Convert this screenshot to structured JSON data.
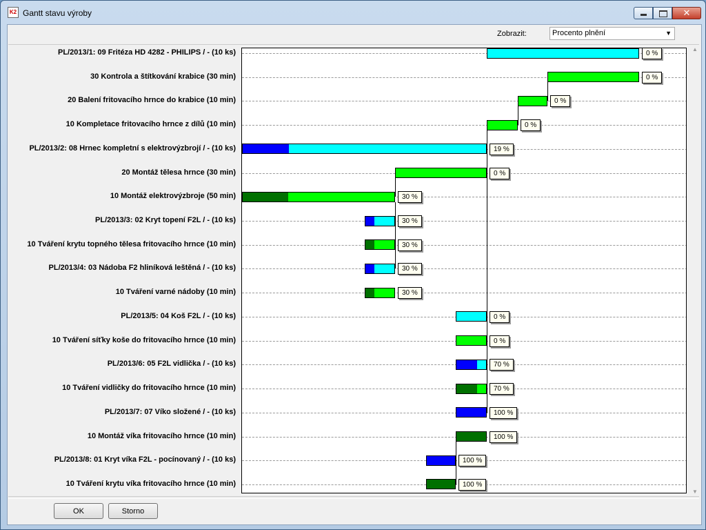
{
  "window": {
    "title": "Gantt stavu výroby",
    "icon": "app-logo-icon",
    "icon_text": "K2"
  },
  "toolbar": {
    "show_label": "Zobrazit:",
    "show_value": "Procento plnění"
  },
  "buttons": {
    "ok": "OK",
    "cancel": "Storno"
  },
  "colors": {
    "order_remaining": "#00ffff",
    "order_done": "#0000ff",
    "operation_remaining": "#00ff00",
    "operation_done": "#007000"
  },
  "gantt": {
    "rows": [
      {
        "label": "PL/2013/1: 09 Fritéza HD 4282 - PHILIPS / - (10 ks)",
        "kind": "order",
        "start": 0.582,
        "end": 0.945,
        "progress": 0,
        "percent": "0 %"
      },
      {
        "label": "30 Kontrola a štítkování krabice (30 min)",
        "kind": "operation",
        "start": 0.727,
        "end": 0.945,
        "progress": 0,
        "percent": "0 %"
      },
      {
        "label": "20 Balení fritovacího hrnce do krabice (10 min)",
        "kind": "operation",
        "start": 0.655,
        "end": 0.727,
        "progress": 0,
        "percent": "0 %"
      },
      {
        "label": "10 Kompletace fritovacího hrnce z dílů (10 min)",
        "kind": "operation",
        "start": 0.582,
        "end": 0.655,
        "progress": 0,
        "percent": "0 %"
      },
      {
        "label": "PL/2013/2: 08 Hrnec kompletní s elektrovýzbrojí / - (10 ks)",
        "kind": "order",
        "start": 0.0,
        "end": 0.582,
        "progress": 0.19,
        "percent": "19 %"
      },
      {
        "label": "20 Montáž tělesa hrnce (30 min)",
        "kind": "operation",
        "start": 0.364,
        "end": 0.582,
        "progress": 0,
        "percent": "0 %"
      },
      {
        "label": "10 Montáž elektrovýzbroje (50 min)",
        "kind": "operation",
        "start": 0.0,
        "end": 0.364,
        "progress": 0.3,
        "percent": "30 %"
      },
      {
        "label": "PL/2013/3: 02 Kryt topení F2L / - (10 ks)",
        "kind": "order",
        "start": 0.291,
        "end": 0.364,
        "progress": 0.3,
        "percent": "30 %"
      },
      {
        "label": "10 Tváření krytu topného tělesa fritovacího hrnce (10 min)",
        "kind": "operation",
        "start": 0.291,
        "end": 0.364,
        "progress": 0.3,
        "percent": "30 %"
      },
      {
        "label": "PL/2013/4: 03 Nádoba F2 hliníková leštěná / - (10 ks)",
        "kind": "order",
        "start": 0.291,
        "end": 0.364,
        "progress": 0.3,
        "percent": "30 %"
      },
      {
        "label": "10 Tváření varné nádoby (10 min)",
        "kind": "operation",
        "start": 0.291,
        "end": 0.364,
        "progress": 0.3,
        "percent": "30 %"
      },
      {
        "label": "PL/2013/5: 04 Koš F2L / - (10 ks)",
        "kind": "order",
        "start": 0.509,
        "end": 0.582,
        "progress": 0,
        "percent": "0 %"
      },
      {
        "label": "10 Tváření síťky koše do fritovacího hrnce (10 min)",
        "kind": "operation",
        "start": 0.509,
        "end": 0.582,
        "progress": 0,
        "percent": "0 %"
      },
      {
        "label": "PL/2013/6: 05 F2L vidlička / - (10 ks)",
        "kind": "order",
        "start": 0.509,
        "end": 0.582,
        "progress": 0.7,
        "percent": "70 %"
      },
      {
        "label": "10 Tváření vidličky do fritovacího hrnce (10 min)",
        "kind": "operation",
        "start": 0.509,
        "end": 0.582,
        "progress": 0.7,
        "percent": "70 %"
      },
      {
        "label": "PL/2013/7: 07 Víko složené / - (10 ks)",
        "kind": "order",
        "start": 0.509,
        "end": 0.582,
        "progress": 1.0,
        "percent": "100 %"
      },
      {
        "label": "10 Montáž víka fritovacího hrnce (10 min)",
        "kind": "operation",
        "start": 0.509,
        "end": 0.582,
        "progress": 1.0,
        "percent": "100 %"
      },
      {
        "label": "PL/2013/8: 01 Kryt víka F2L - pocínovaný / - (10 ks)",
        "kind": "order",
        "start": 0.437,
        "end": 0.509,
        "progress": 1.0,
        "percent": "100 %"
      },
      {
        "label": "10 Tváření krytu víka fritovacího hrnce (10 min)",
        "kind": "operation",
        "start": 0.437,
        "end": 0.509,
        "progress": 1.0,
        "percent": "100 %"
      }
    ],
    "links": [
      {
        "from": 3,
        "to": 2
      },
      {
        "from": 2,
        "to": 1
      },
      {
        "from": 5,
        "to": 3
      },
      {
        "from": 6,
        "to": 5
      },
      {
        "from": 7,
        "to": 6
      },
      {
        "from": 9,
        "to": 6
      },
      {
        "from": 11,
        "to": 3
      },
      {
        "from": 13,
        "to": 3
      },
      {
        "from": 15,
        "to": 3
      },
      {
        "from": 18,
        "to": 16
      }
    ]
  }
}
